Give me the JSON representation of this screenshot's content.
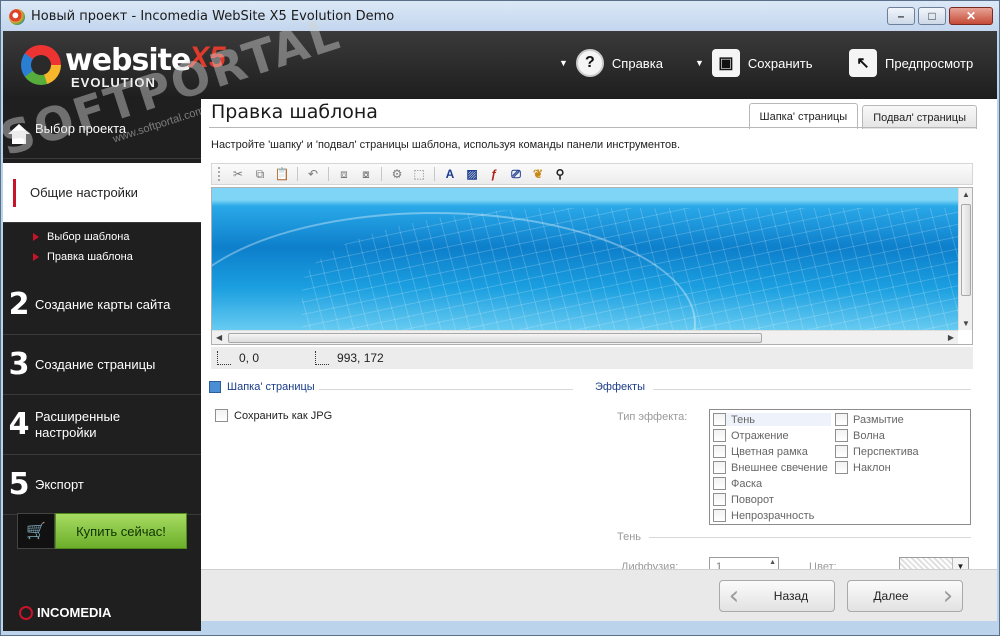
{
  "window": {
    "title": "Новый проект - Incomedia WebSite X5 Evolution Demo"
  },
  "header": {
    "brand": "website",
    "brand_suffix": "X5",
    "edition": "EVOLUTION",
    "help_label": "Справка",
    "save_label": "Сохранить",
    "preview_label": "Предпросмотр"
  },
  "watermark": {
    "text": "SOFTPORTAL",
    "url": "www.softportal.com"
  },
  "sidebar": {
    "home": "Выбор проекта",
    "step1": {
      "label": "Общие настройки"
    },
    "subitems": [
      "Выбор шаблона",
      "Правка шаблона"
    ],
    "steps": [
      {
        "num": "2",
        "label": "Создание карты сайта"
      },
      {
        "num": "3",
        "label": "Создание страницы"
      },
      {
        "num": "4",
        "label": "Расширенные настройки"
      },
      {
        "num": "5",
        "label": "Экспорт"
      }
    ],
    "buy_label": "Купить сейчас!",
    "company": "INCOMEDIA"
  },
  "main": {
    "title": "Правка шаблона",
    "tabs": [
      "Шапка' страницы",
      "Подвал' страницы"
    ],
    "active_tab": 0,
    "intro": "Настройте 'шапку' и 'подвал' страницы шаблона, используя команды панели инструментов.",
    "coords_pos": "0, 0",
    "coords_size": "993, 172",
    "section_header": "Шапка' страницы",
    "save_jpg_label": "Сохранить как JPG",
    "effects_title": "Эффекты",
    "effect_type_label": "Тип эффекта:",
    "effects_col1": [
      "Тень",
      "Отражение",
      "Цветная рамка",
      "Внешнее свечение",
      "Фаска",
      "Поворот",
      "Непрозрачность"
    ],
    "effects_col2": [
      "Размытие",
      "Волна",
      "Перспектива",
      "Наклон"
    ],
    "shadow_label": "Тень",
    "diffusion_label": "Диффузия:",
    "diffusion_value": "1",
    "color_label": "Цвет:"
  },
  "footer": {
    "back_label": "Назад",
    "next_label": "Далее"
  }
}
